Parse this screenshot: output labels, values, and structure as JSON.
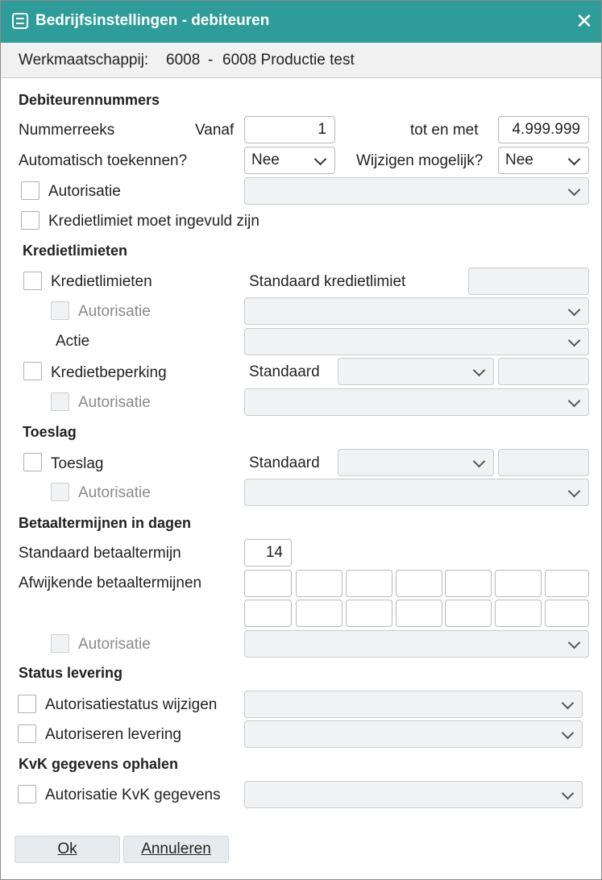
{
  "title": "Bedrijfsinstellingen - debiteuren",
  "company": {
    "label": "Werkmaatschappij:",
    "code": "6008",
    "separator": "-",
    "name": "6008 Productie test"
  },
  "debiteurennummers": {
    "heading": "Debiteurennummers",
    "nummerreeks": "Nummerreeks",
    "vanaf_label": "Vanaf",
    "vanaf_value": "1",
    "tot_label": "tot en met",
    "tot_value": "4.999.999",
    "auto_label": "Automatisch toekennen?",
    "auto_value": "Nee",
    "wijzigen_label": "Wijzigen mogelijk?",
    "wijzigen_value": "Nee",
    "autorisatie_label": "Autorisatie",
    "kredietlimiet_verplicht_label": "Kredietlimiet moet ingevuld zijn"
  },
  "kredietlimieten": {
    "heading": "Kredietlimieten",
    "kredietlimieten_label": "Kredietlimieten",
    "standaard_kredietlimiet_label": "Standaard kredietlimiet",
    "autorisatie_label": "Autorisatie",
    "actie_label": "Actie",
    "kredietbeperking_label": "Kredietbeperking",
    "standaard_label": "Standaard",
    "autorisatie2_label": "Autorisatie"
  },
  "toeslag": {
    "heading": "Toeslag",
    "toeslag_label": "Toeslag",
    "standaard_label": "Standaard",
    "autorisatie_label": "Autorisatie"
  },
  "betaaltermijnen": {
    "heading": "Betaaltermijnen in dagen",
    "standaard_label": "Standaard betaaltermijn",
    "standaard_value": "14",
    "afwijkend_label": "Afwijkende betaaltermijnen",
    "autorisatie_label": "Autorisatie"
  },
  "status_levering": {
    "heading": "Status levering",
    "autorisatiestatus_label": "Autorisatiestatus wijzigen",
    "autoriseren_label": "Autoriseren levering"
  },
  "kvk": {
    "heading": "KvK gegevens ophalen",
    "autorisatie_label": "Autorisatie KvK gegevens"
  },
  "buttons": {
    "ok": "Ok",
    "cancel": "Annuleren"
  },
  "colors": {
    "titlebar": "#2e9d99",
    "disabled_field": "#f1f2f4"
  },
  "icons": {
    "app": "settings-list-icon",
    "close": "close-icon",
    "dropdown": "chevron-down-icon"
  }
}
